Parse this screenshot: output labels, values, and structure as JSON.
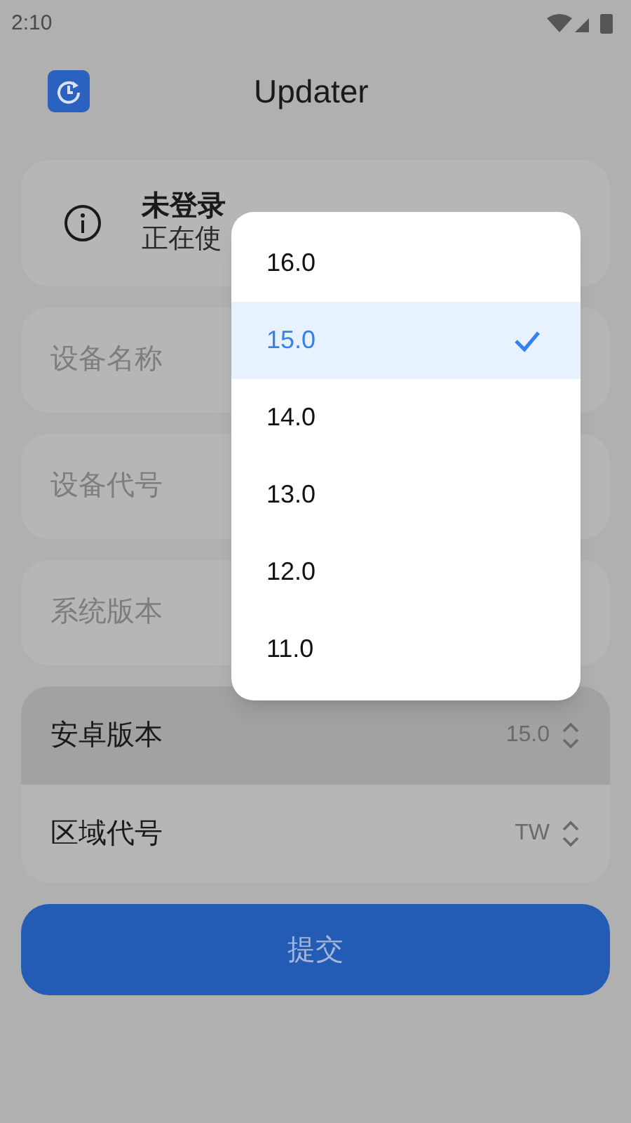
{
  "status_bar": {
    "time": "2:10"
  },
  "app_bar": {
    "title": "Updater"
  },
  "login_card": {
    "title": "未登录",
    "subtitle": "正在使"
  },
  "fields": [
    {
      "placeholder": "设备名称"
    },
    {
      "placeholder": "设备代号"
    },
    {
      "placeholder": "系统版本"
    }
  ],
  "selects": [
    {
      "label": "安卓版本",
      "value": "15.0",
      "highlighted": true
    },
    {
      "label": "区域代号",
      "value": "TW",
      "highlighted": false
    }
  ],
  "submit_button": {
    "label": "提交"
  },
  "dropdown": {
    "options": [
      {
        "label": "16.0",
        "selected": false
      },
      {
        "label": "15.0",
        "selected": true
      },
      {
        "label": "14.0",
        "selected": false
      },
      {
        "label": "13.0",
        "selected": false
      },
      {
        "label": "12.0",
        "selected": false
      },
      {
        "label": "11.0",
        "selected": false
      }
    ]
  }
}
